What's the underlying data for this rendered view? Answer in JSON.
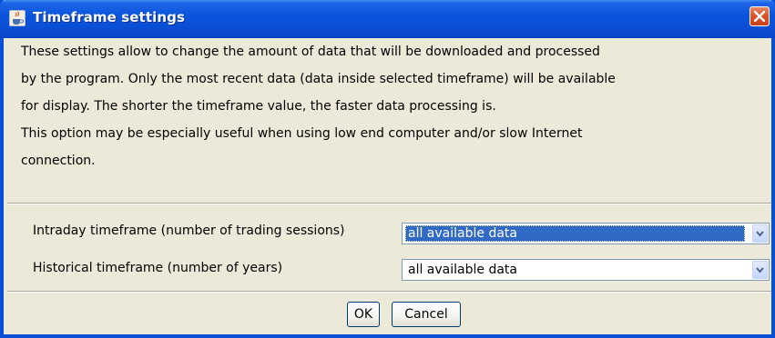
{
  "window": {
    "title": "Timeframe settings",
    "icon": "java-cup-icon",
    "close_icon": "close-icon"
  },
  "description": {
    "lines": [
      "These settings allow to change the amount of data that will be downloaded and processed",
      "by the program. Only the most recent data (data inside selected timeframe) will be available",
      "for display. The shorter the timeframe value, the faster data processing is.",
      "This option may be especially useful when using low end computer and/or slow Internet",
      "connection."
    ]
  },
  "settings": {
    "intraday": {
      "label": "Intraday timeframe (number of trading sessions)",
      "value": "all available data"
    },
    "historical": {
      "label": "Historical timeframe (number of years)",
      "value": "all available data"
    }
  },
  "buttons": {
    "ok": "OK",
    "cancel": "Cancel"
  },
  "colors": {
    "titlebar": "#0a4fd6",
    "dialog_bg": "#ece9d8",
    "selection": "#316ac5",
    "close_button": "#d9542b"
  }
}
